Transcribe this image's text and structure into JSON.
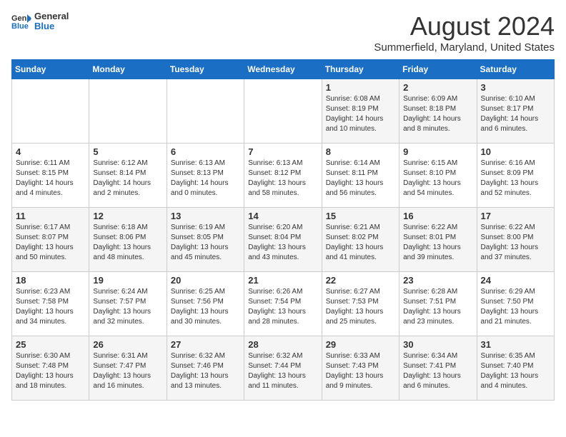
{
  "header": {
    "logo_general": "General",
    "logo_blue": "Blue",
    "month_title": "August 2024",
    "subtitle": "Summerfield, Maryland, United States"
  },
  "days_of_week": [
    "Sunday",
    "Monday",
    "Tuesday",
    "Wednesday",
    "Thursday",
    "Friday",
    "Saturday"
  ],
  "weeks": [
    [
      {
        "day": "",
        "info": ""
      },
      {
        "day": "",
        "info": ""
      },
      {
        "day": "",
        "info": ""
      },
      {
        "day": "",
        "info": ""
      },
      {
        "day": "1",
        "info": "Sunrise: 6:08 AM\nSunset: 8:19 PM\nDaylight: 14 hours\nand 10 minutes."
      },
      {
        "day": "2",
        "info": "Sunrise: 6:09 AM\nSunset: 8:18 PM\nDaylight: 14 hours\nand 8 minutes."
      },
      {
        "day": "3",
        "info": "Sunrise: 6:10 AM\nSunset: 8:17 PM\nDaylight: 14 hours\nand 6 minutes."
      }
    ],
    [
      {
        "day": "4",
        "info": "Sunrise: 6:11 AM\nSunset: 8:15 PM\nDaylight: 14 hours\nand 4 minutes."
      },
      {
        "day": "5",
        "info": "Sunrise: 6:12 AM\nSunset: 8:14 PM\nDaylight: 14 hours\nand 2 minutes."
      },
      {
        "day": "6",
        "info": "Sunrise: 6:13 AM\nSunset: 8:13 PM\nDaylight: 14 hours\nand 0 minutes."
      },
      {
        "day": "7",
        "info": "Sunrise: 6:13 AM\nSunset: 8:12 PM\nDaylight: 13 hours\nand 58 minutes."
      },
      {
        "day": "8",
        "info": "Sunrise: 6:14 AM\nSunset: 8:11 PM\nDaylight: 13 hours\nand 56 minutes."
      },
      {
        "day": "9",
        "info": "Sunrise: 6:15 AM\nSunset: 8:10 PM\nDaylight: 13 hours\nand 54 minutes."
      },
      {
        "day": "10",
        "info": "Sunrise: 6:16 AM\nSunset: 8:09 PM\nDaylight: 13 hours\nand 52 minutes."
      }
    ],
    [
      {
        "day": "11",
        "info": "Sunrise: 6:17 AM\nSunset: 8:07 PM\nDaylight: 13 hours\nand 50 minutes."
      },
      {
        "day": "12",
        "info": "Sunrise: 6:18 AM\nSunset: 8:06 PM\nDaylight: 13 hours\nand 48 minutes."
      },
      {
        "day": "13",
        "info": "Sunrise: 6:19 AM\nSunset: 8:05 PM\nDaylight: 13 hours\nand 45 minutes."
      },
      {
        "day": "14",
        "info": "Sunrise: 6:20 AM\nSunset: 8:04 PM\nDaylight: 13 hours\nand 43 minutes."
      },
      {
        "day": "15",
        "info": "Sunrise: 6:21 AM\nSunset: 8:02 PM\nDaylight: 13 hours\nand 41 minutes."
      },
      {
        "day": "16",
        "info": "Sunrise: 6:22 AM\nSunset: 8:01 PM\nDaylight: 13 hours\nand 39 minutes."
      },
      {
        "day": "17",
        "info": "Sunrise: 6:22 AM\nSunset: 8:00 PM\nDaylight: 13 hours\nand 37 minutes."
      }
    ],
    [
      {
        "day": "18",
        "info": "Sunrise: 6:23 AM\nSunset: 7:58 PM\nDaylight: 13 hours\nand 34 minutes."
      },
      {
        "day": "19",
        "info": "Sunrise: 6:24 AM\nSunset: 7:57 PM\nDaylight: 13 hours\nand 32 minutes."
      },
      {
        "day": "20",
        "info": "Sunrise: 6:25 AM\nSunset: 7:56 PM\nDaylight: 13 hours\nand 30 minutes."
      },
      {
        "day": "21",
        "info": "Sunrise: 6:26 AM\nSunset: 7:54 PM\nDaylight: 13 hours\nand 28 minutes."
      },
      {
        "day": "22",
        "info": "Sunrise: 6:27 AM\nSunset: 7:53 PM\nDaylight: 13 hours\nand 25 minutes."
      },
      {
        "day": "23",
        "info": "Sunrise: 6:28 AM\nSunset: 7:51 PM\nDaylight: 13 hours\nand 23 minutes."
      },
      {
        "day": "24",
        "info": "Sunrise: 6:29 AM\nSunset: 7:50 PM\nDaylight: 13 hours\nand 21 minutes."
      }
    ],
    [
      {
        "day": "25",
        "info": "Sunrise: 6:30 AM\nSunset: 7:48 PM\nDaylight: 13 hours\nand 18 minutes."
      },
      {
        "day": "26",
        "info": "Sunrise: 6:31 AM\nSunset: 7:47 PM\nDaylight: 13 hours\nand 16 minutes."
      },
      {
        "day": "27",
        "info": "Sunrise: 6:32 AM\nSunset: 7:46 PM\nDaylight: 13 hours\nand 13 minutes."
      },
      {
        "day": "28",
        "info": "Sunrise: 6:32 AM\nSunset: 7:44 PM\nDaylight: 13 hours\nand 11 minutes."
      },
      {
        "day": "29",
        "info": "Sunrise: 6:33 AM\nSunset: 7:43 PM\nDaylight: 13 hours\nand 9 minutes."
      },
      {
        "day": "30",
        "info": "Sunrise: 6:34 AM\nSunset: 7:41 PM\nDaylight: 13 hours\nand 6 minutes."
      },
      {
        "day": "31",
        "info": "Sunrise: 6:35 AM\nSunset: 7:40 PM\nDaylight: 13 hours\nand 4 minutes."
      }
    ]
  ]
}
